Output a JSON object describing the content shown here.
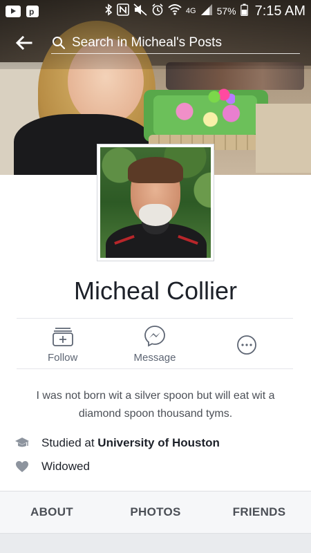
{
  "status_bar": {
    "battery_pct": "57%",
    "time": "7:15 AM",
    "network": "4G"
  },
  "search": {
    "placeholder": "Search in Micheal's Posts"
  },
  "profile": {
    "name": "Micheal Collier",
    "bio": "I was not born wit a silver spoon but will eat wit a diamond spoon thousand tyms."
  },
  "actions": [
    {
      "label": "Follow",
      "icon": "follow-icon"
    },
    {
      "label": "Message",
      "icon": "messenger-icon"
    },
    {
      "label": "",
      "icon": "more-icon"
    }
  ],
  "info": {
    "education_prefix": "Studied at",
    "education_school": "University of Houston",
    "relationship": "Widowed"
  },
  "tabs": [
    {
      "label": "ABOUT"
    },
    {
      "label": "PHOTOS"
    },
    {
      "label": "FRIENDS"
    }
  ],
  "colors": {
    "text_primary": "#1d2129",
    "text_secondary": "#4b4f56",
    "icon_gray": "#5d6573",
    "tab_bar_bg": "#f6f7f9"
  }
}
